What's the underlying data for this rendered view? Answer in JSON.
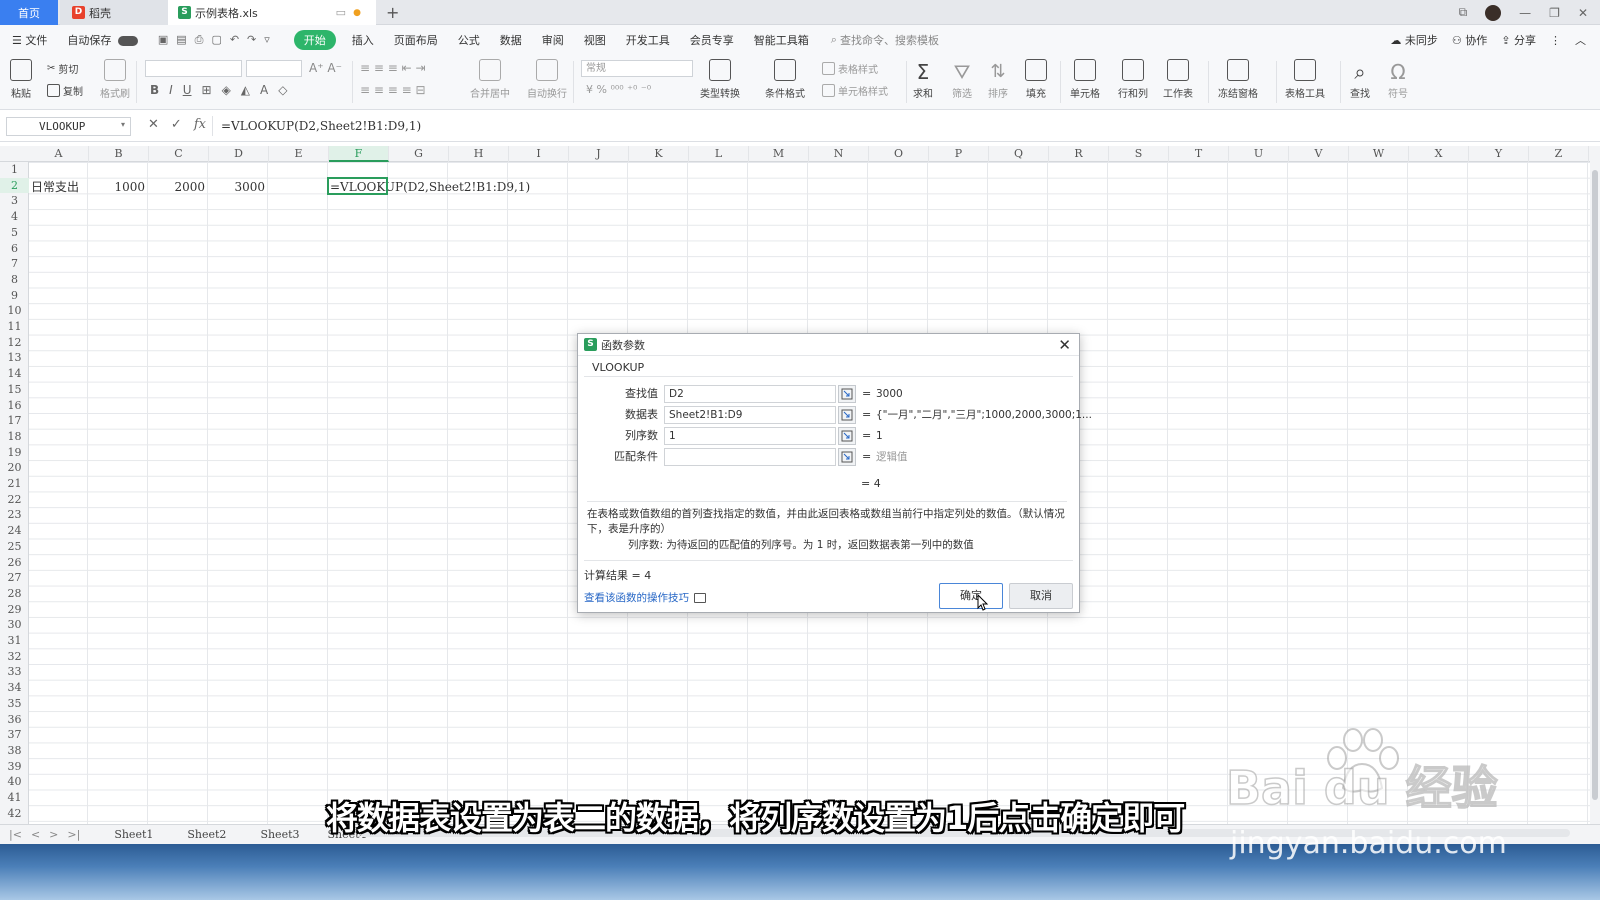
{
  "tabs": {
    "home": "首页",
    "docer": "稻壳",
    "file": "示例表格.xls",
    "add": "+"
  },
  "menu": {
    "file": "文件",
    "autosave": "自动保存",
    "items": [
      "开始",
      "插入",
      "页面布局",
      "公式",
      "数据",
      "审阅",
      "视图",
      "开发工具",
      "会员专享",
      "智能工具箱"
    ],
    "search": "查找命令、搜索模板",
    "right": [
      "未同步",
      "协作",
      "分享"
    ]
  },
  "ribbon": {
    "paste": "粘贴",
    "cut": "剪切",
    "copy": "复制",
    "format_painter": "格式刷",
    "merge_center": "合并居中",
    "wrap": "自动换行",
    "number_format": "常规",
    "type_convert": "类型转换",
    "cond_format": "条件格式",
    "table_style": "表格样式",
    "cell_style": "单元格样式",
    "sum": "求和",
    "filter": "筛选",
    "sort": "排序",
    "fill": "填充",
    "cell": "单元格",
    "row_col": "行和列",
    "worksheet": "工作表",
    "freeze": "冻结窗格",
    "table_tools": "表格工具",
    "find": "查找",
    "symbol": "符号"
  },
  "formula_bar": {
    "name_box": "VLOOKUP",
    "fx": "fx",
    "formula": "=VLOOKUP(D2,Sheet2!B1:D9,1)"
  },
  "grid": {
    "columns": [
      "A",
      "B",
      "C",
      "D",
      "E",
      "F",
      "G",
      "H",
      "I",
      "J",
      "K",
      "L",
      "M",
      "N",
      "O",
      "P",
      "Q",
      "R",
      "S",
      "T",
      "U",
      "V",
      "W",
      "X",
      "Y",
      "Z"
    ],
    "selected_column": "F",
    "row_count": 42,
    "cells": {
      "A2": "日常支出",
      "B2": "1000",
      "C2": "2000",
      "D2": "3000",
      "F2": "=VLOOKUP(D2,Sheet2!B1:D9,1)"
    }
  },
  "sheets": [
    "Sheet1",
    "Sheet2",
    "Sheet3",
    "Sheet4"
  ],
  "dialog": {
    "title": "函数参数",
    "function_name": "VLOOKUP",
    "args": [
      {
        "label": "查找值",
        "value": "D2",
        "result": "3000"
      },
      {
        "label": "数据表",
        "value": "Sheet2!B1:D9",
        "result": "{\"一月\",\"二月\",\"三月\";1000,2000,3000;1..."
      },
      {
        "label": "列序数",
        "value": "1",
        "result": "1"
      },
      {
        "label": "匹配条件",
        "value": "",
        "result": "逻辑值"
      }
    ],
    "result_line": "= 4",
    "description": "在表格或数值数组的首列查找指定的数值，并由此返回表格或数组当前行中指定列处的数值。（默认情况下，表是升序的）",
    "arg_description": "列序数:   为待返回的匹配值的列序号。为 1 时，返回数据表第一列中的数值",
    "calc_result": "计算结果  =  4",
    "help_link": "查看该函数的操作技巧",
    "ok": "确定",
    "cancel": "取消"
  },
  "subtitle": "将数据表设置为表二的数据，将列序数设置为1后点击确定即可",
  "watermark": {
    "logo": "Bai du 经验",
    "url": "jingyan.baidu.com"
  }
}
